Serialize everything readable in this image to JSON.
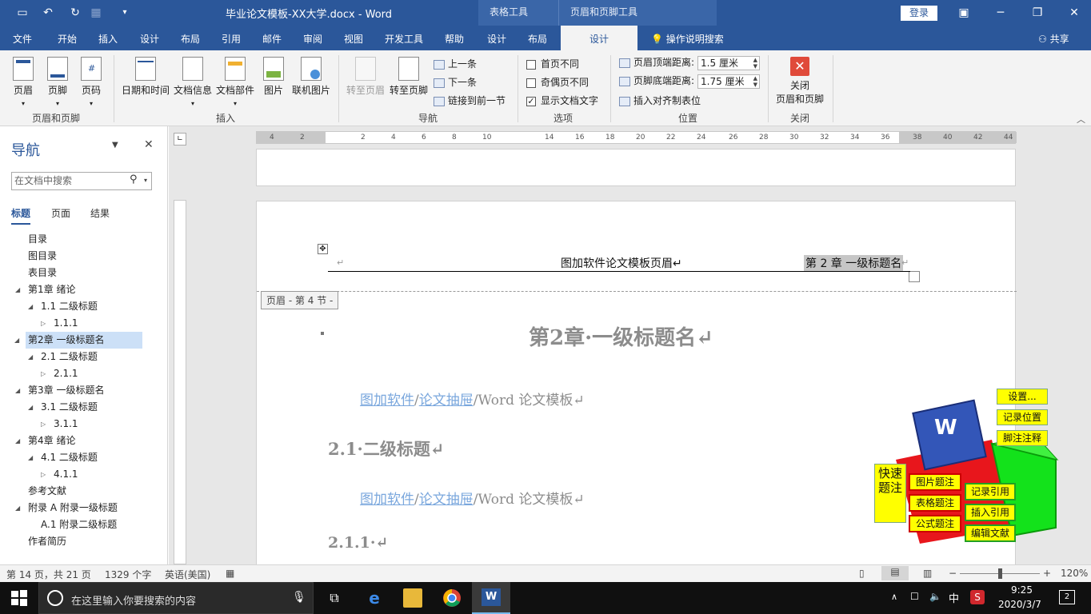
{
  "titlebar": {
    "document_title": "毕业论文模板-XX大学.docx  -  Word",
    "context_tab_table": "表格工具",
    "context_tab_header": "页眉和页脚工具",
    "login": "登录"
  },
  "menu": {
    "tabs": [
      "文件",
      "开始",
      "插入",
      "设计",
      "布局",
      "引用",
      "邮件",
      "审阅",
      "视图",
      "开发工具",
      "帮助",
      "设计",
      "布局",
      "设计"
    ],
    "active_tab": "设计",
    "tell_me": "操作说明搜索",
    "share": "共享"
  },
  "ribbon": {
    "header_footer": {
      "header": "页眉",
      "footer": "页脚",
      "page_number": "页码",
      "group": "页眉和页脚"
    },
    "insert": {
      "datetime": "日期和时间",
      "docinfo": "文档信息",
      "quickparts": "文档部件",
      "picture": "图片",
      "online_picture": "联机图片",
      "group": "插入"
    },
    "navigation": {
      "goto_header": "转至页眉",
      "goto_footer": "转至页脚",
      "prev": "上一条",
      "next": "下一条",
      "link_prev": "链接到前一节",
      "group": "导航"
    },
    "options": {
      "diff_first": "首页不同",
      "diff_odd_even": "奇偶页不同",
      "show_doc_text": "显示文档文字",
      "show_doc_text_checked": true,
      "group": "选项"
    },
    "position": {
      "header_top_label": "页眉顶端距离:",
      "header_top_value": "1.5 厘米",
      "footer_bottom_label": "页脚底端距离:",
      "footer_bottom_value": "1.75 厘米",
      "insert_align_tab": "插入对齐制表位",
      "group": "位置"
    },
    "close": {
      "close_label_1": "关闭",
      "close_label_2": "页眉和页脚",
      "group": "关闭"
    }
  },
  "nav_pane": {
    "title": "导航",
    "search_placeholder": "在文档中搜索",
    "tabs": [
      "标题",
      "页面",
      "结果"
    ],
    "items": [
      {
        "label": "目录",
        "level": 1,
        "tri": ""
      },
      {
        "label": "图目录",
        "level": 1,
        "tri": ""
      },
      {
        "label": "表目录",
        "level": 1,
        "tri": ""
      },
      {
        "label": "第1章 绪论",
        "level": 1,
        "tri": "◢"
      },
      {
        "label": "1.1 二级标题",
        "level": 2,
        "tri": "◢"
      },
      {
        "label": "1.1.1",
        "level": 3,
        "tri": "▷"
      },
      {
        "label": "第2章 一级标题名",
        "level": 1,
        "tri": "◢",
        "selected": true
      },
      {
        "label": "2.1 二级标题",
        "level": 2,
        "tri": "◢"
      },
      {
        "label": "2.1.1",
        "level": 3,
        "tri": "▷"
      },
      {
        "label": "第3章 一级标题名",
        "level": 1,
        "tri": "◢"
      },
      {
        "label": "3.1 二级标题",
        "level": 2,
        "tri": "◢"
      },
      {
        "label": "3.1.1",
        "level": 3,
        "tri": "▷"
      },
      {
        "label": "第4章 绪论",
        "level": 1,
        "tri": "◢"
      },
      {
        "label": "4.1 二级标题",
        "level": 2,
        "tri": "◢"
      },
      {
        "label": "4.1.1",
        "level": 3,
        "tri": "▷"
      },
      {
        "label": "参考文献",
        "level": 1,
        "tri": ""
      },
      {
        "label": "附录 A 附录一级标题",
        "level": 1,
        "tri": "◢"
      },
      {
        "label": "A.1 附录二级标题",
        "level": 2,
        "tri": ""
      },
      {
        "label": "作者简历",
        "level": 1,
        "tri": ""
      }
    ]
  },
  "ruler": {
    "ticks": [
      "4",
      "2",
      "2",
      "4",
      "6",
      "8",
      "10",
      "14",
      "16",
      "18",
      "20",
      "22",
      "24",
      "26",
      "28",
      "30",
      "32",
      "34",
      "36",
      "38",
      "40",
      "42",
      "44"
    ]
  },
  "document": {
    "header_center": "图加软件论文模板页眉↵",
    "header_right": "第 2 章 一级标题名",
    "header_right_mark": "↵",
    "header_left_mark": "↵",
    "header_tag": "页眉 - 第 4 节 -",
    "heading1": "第2章·一级标题名↵",
    "para1_link1": "图加软件",
    "para1_sep": "/",
    "para1_link2": "论文抽屉",
    "para1_tail": "/Word 论文模板↵",
    "heading2": "2.1·二级标题↵",
    "para2_link1": "图加软件",
    "para2_sep": "/",
    "para2_link2": "论文抽屉",
    "para2_tail": "/Word 论文模板↵",
    "heading3": "2.1.1·↵"
  },
  "addin": {
    "settings": "设置...",
    "record_position": "记录位置",
    "footnote": "脚注注释",
    "quick_caption": "快速题注",
    "picture_caption": "图片题注",
    "table_caption": "表格题注",
    "formula_caption": "公式题注",
    "record_ref": "记录引用",
    "insert_ref": "插入引用",
    "edit_bib": "编辑文献",
    "word_logo": "W"
  },
  "statusbar": {
    "page": "第 14 页，共 21 页",
    "words": "1329 个字",
    "language": "英语(美国)",
    "zoom": "120%"
  },
  "taskbar": {
    "search": "在这里输入你要搜索的内容",
    "ime": "中",
    "time": "9:25",
    "date": "2020/3/7",
    "notif_count": "2"
  }
}
